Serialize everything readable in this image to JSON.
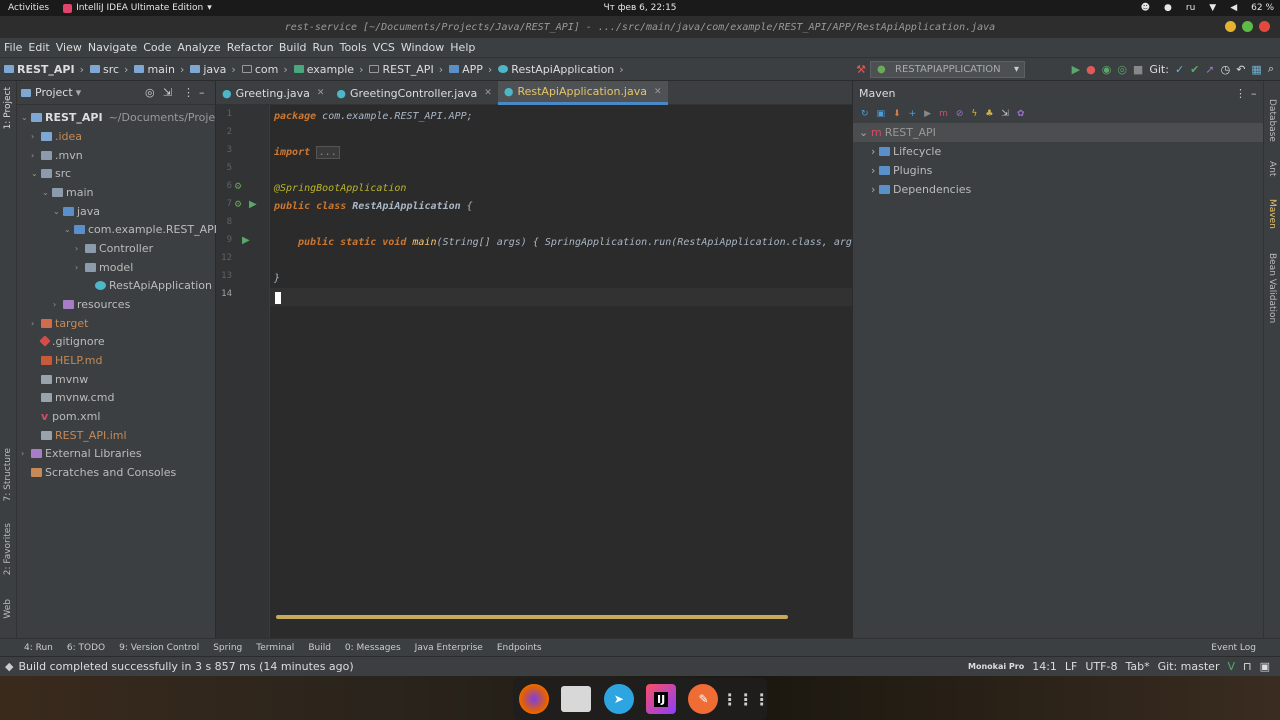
{
  "gnome": {
    "activities": "Activities",
    "app_name": "IntelliJ IDEA Ultimate Edition",
    "clock": "Чт фев 6, 22:15",
    "lang": "ru",
    "battery": "62 %"
  },
  "window_title": "rest-service [~/Documents/Projects/Java/REST_API] - .../src/main/java/com/example/REST_API/APP/RestApiApplication.java",
  "menu": [
    "File",
    "Edit",
    "View",
    "Navigate",
    "Code",
    "Analyze",
    "Refactor",
    "Build",
    "Run",
    "Tools",
    "VCS",
    "Window",
    "Help"
  ],
  "breadcrumbs": [
    "REST_API",
    "src",
    "main",
    "java",
    "com",
    "example",
    "REST_API",
    "APP",
    "RestApiApplication"
  ],
  "run_config": "RESTAPIAPPLICATION",
  "git_label": "Git:",
  "project_panel": {
    "title": "Project",
    "tree": [
      {
        "label": "REST_API",
        "extra": "~/Documents/Projects/",
        "color": "#dddddd"
      },
      {
        "label": ".idea",
        "color": "#c58a56"
      },
      {
        "label": ".mvn",
        "color": "#bbbbbb"
      },
      {
        "label": "src",
        "color": "#bbbbbb"
      },
      {
        "label": "main",
        "color": "#bbbbbb"
      },
      {
        "label": "java",
        "color": "#bbbbbb"
      },
      {
        "label": "com.example.REST_API.A",
        "color": "#bbbbbb"
      },
      {
        "label": "Controller",
        "color": "#bbbbbb"
      },
      {
        "label": "model",
        "color": "#bbbbbb"
      },
      {
        "label": "RestApiApplication",
        "color": "#bbbbbb"
      },
      {
        "label": "resources",
        "color": "#bbbbbb"
      },
      {
        "label": "target",
        "color": "#c58a56"
      },
      {
        "label": ".gitignore",
        "color": "#bbbbbb"
      },
      {
        "label": "HELP.md",
        "color": "#c58a56"
      },
      {
        "label": "mvnw",
        "color": "#bbbbbb"
      },
      {
        "label": "mvnw.cmd",
        "color": "#bbbbbb"
      },
      {
        "label": "pom.xml",
        "color": "#bbbbbb"
      },
      {
        "label": "REST_API.iml",
        "color": "#c58a56"
      },
      {
        "label": "External Libraries",
        "color": "#bbbbbb"
      },
      {
        "label": "Scratches and Consoles",
        "color": "#bbbbbb"
      }
    ]
  },
  "tabs": [
    {
      "label": "Greeting.java"
    },
    {
      "label": "GreetingController.java"
    },
    {
      "label": "RestApiApplication.java"
    }
  ],
  "line_numbers": [
    "1",
    "2",
    "3",
    "5",
    "6",
    "7",
    "8",
    "9",
    "12",
    "13",
    "14"
  ],
  "code": {
    "l1_kw": "package",
    "l1_rest": " com.example.REST_API.APP;",
    "l3_kw": "import",
    "l3_fold": "...",
    "l6": "@SpringBootApplication",
    "l7_kw": "public class",
    "l7_name": " RestApiApplication",
    "l7_rest": " {",
    "l9_kw": "public static void",
    "l9_fn": " main",
    "l9_rest": "(String[] args) { SpringApplication.run(RestApiApplication.class, args",
    "l13": "}"
  },
  "maven": {
    "title": "Maven",
    "root": "REST_API",
    "items": [
      "Lifecycle",
      "Plugins",
      "Dependencies"
    ]
  },
  "left_tools": [
    "1: Project",
    "7: Structure",
    "2: Favorites",
    "Web"
  ],
  "right_tools": [
    "Database",
    "Ant",
    "Maven",
    "Bean Validation"
  ],
  "bottom_tabs": [
    "4: Run",
    "6: TODO",
    "9: Version Control",
    "Spring",
    "Terminal",
    "Build",
    "0: Messages",
    "Java Enterprise",
    "Endpoints",
    "Event Log"
  ],
  "status": {
    "message": "Build completed successfully in 3 s 857 ms (14 minutes ago)",
    "theme": "Monokai Pro",
    "position": "14:1",
    "sep": "LF",
    "encoding": "UTF-8",
    "indent": "Tab*",
    "git": "Git: master"
  },
  "dock": {
    "ij": "IJ"
  }
}
